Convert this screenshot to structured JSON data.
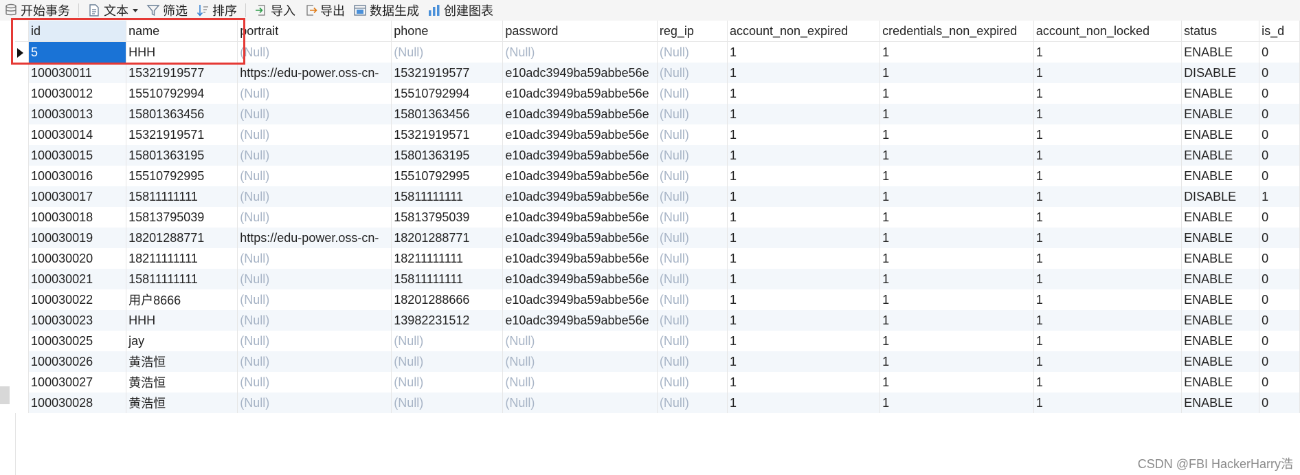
{
  "toolbar": {
    "begin_transaction": "开始事务",
    "text": "文本",
    "filter": "筛选",
    "sort": "排序",
    "import": "导入",
    "export": "导出",
    "generate_data": "数据生成",
    "create_chart": "创建图表"
  },
  "grid": {
    "columns": [
      "id",
      "name",
      "portrait",
      "phone",
      "password",
      "reg_ip",
      "account_non_expired",
      "credentials_non_expired",
      "account_non_locked",
      "status",
      "is_d"
    ],
    "rows": [
      [
        "5",
        "HHH",
        "(Null)",
        "(Null)",
        "(Null)",
        "(Null)",
        "1",
        "1",
        "1",
        "ENABLE",
        "0"
      ],
      [
        "100030011",
        "15321919577",
        "https://edu-power.oss-cn-",
        "15321919577",
        "e10adc3949ba59abbe56e",
        "(Null)",
        "1",
        "1",
        "1",
        "DISABLE",
        "0"
      ],
      [
        "100030012",
        "15510792994",
        "(Null)",
        "15510792994",
        "e10adc3949ba59abbe56e",
        "(Null)",
        "1",
        "1",
        "1",
        "ENABLE",
        "0"
      ],
      [
        "100030013",
        "15801363456",
        "(Null)",
        "15801363456",
        "e10adc3949ba59abbe56e",
        "(Null)",
        "1",
        "1",
        "1",
        "ENABLE",
        "0"
      ],
      [
        "100030014",
        "15321919571",
        "(Null)",
        "15321919571",
        "e10adc3949ba59abbe56e",
        "(Null)",
        "1",
        "1",
        "1",
        "ENABLE",
        "0"
      ],
      [
        "100030015",
        "15801363195",
        "(Null)",
        "15801363195",
        "e10adc3949ba59abbe56e",
        "(Null)",
        "1",
        "1",
        "1",
        "ENABLE",
        "0"
      ],
      [
        "100030016",
        "15510792995",
        "(Null)",
        "15510792995",
        "e10adc3949ba59abbe56e",
        "(Null)",
        "1",
        "1",
        "1",
        "ENABLE",
        "0"
      ],
      [
        "100030017",
        "15811111111",
        "(Null)",
        "15811111111",
        "e10adc3949ba59abbe56e",
        "(Null)",
        "1",
        "1",
        "1",
        "DISABLE",
        "1"
      ],
      [
        "100030018",
        "15813795039",
        "(Null)",
        "15813795039",
        "e10adc3949ba59abbe56e",
        "(Null)",
        "1",
        "1",
        "1",
        "ENABLE",
        "0"
      ],
      [
        "100030019",
        "18201288771",
        "https://edu-power.oss-cn-",
        "18201288771",
        "e10adc3949ba59abbe56e",
        "(Null)",
        "1",
        "1",
        "1",
        "ENABLE",
        "0"
      ],
      [
        "100030020",
        "18211111111",
        "(Null)",
        "18211111111",
        "e10adc3949ba59abbe56e",
        "(Null)",
        "1",
        "1",
        "1",
        "ENABLE",
        "0"
      ],
      [
        "100030021",
        "15811111111",
        "(Null)",
        "15811111111",
        "e10adc3949ba59abbe56e",
        "(Null)",
        "1",
        "1",
        "1",
        "ENABLE",
        "0"
      ],
      [
        "100030022",
        "用户8666",
        "(Null)",
        "18201288666",
        "e10adc3949ba59abbe56e",
        "(Null)",
        "1",
        "1",
        "1",
        "ENABLE",
        "0"
      ],
      [
        "100030023",
        "HHH",
        "(Null)",
        "13982231512",
        "e10adc3949ba59abbe56e",
        "(Null)",
        "1",
        "1",
        "1",
        "ENABLE",
        "0"
      ],
      [
        "100030025",
        "jay",
        "(Null)",
        "(Null)",
        "(Null)",
        "(Null)",
        "1",
        "1",
        "1",
        "ENABLE",
        "0"
      ],
      [
        "100030026",
        "黄浩恒",
        "(Null)",
        "(Null)",
        "(Null)",
        "(Null)",
        "1",
        "1",
        "1",
        "ENABLE",
        "0"
      ],
      [
        "100030027",
        "黄浩恒",
        "(Null)",
        "(Null)",
        "(Null)",
        "(Null)",
        "1",
        "1",
        "1",
        "ENABLE",
        "0"
      ],
      [
        "100030028",
        "黄浩恒",
        "(Null)",
        "(Null)",
        "(Null)",
        "(Null)",
        "1",
        "1",
        "1",
        "ENABLE",
        "0"
      ]
    ]
  },
  "watermark": "CSDN @FBI HackerHarry浩"
}
